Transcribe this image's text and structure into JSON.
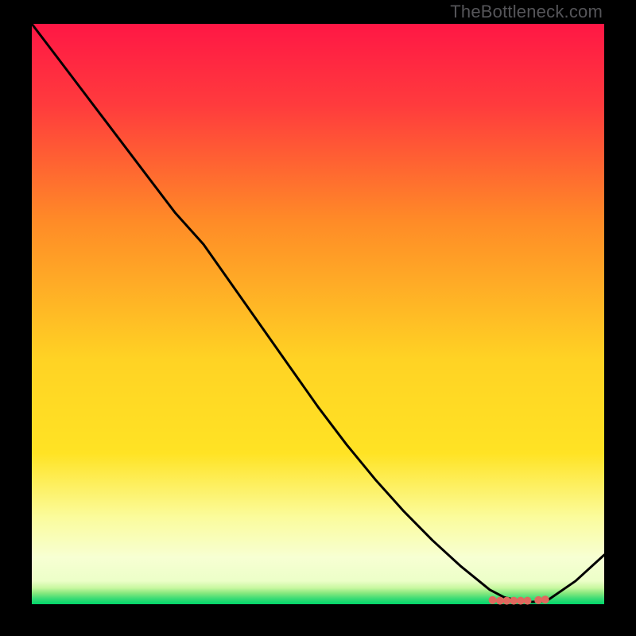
{
  "watermark": "TheBottleneck.com",
  "chart_data": {
    "type": "line",
    "x": [
      0.0,
      0.05,
      0.1,
      0.15,
      0.2,
      0.25,
      0.3,
      0.35,
      0.4,
      0.45,
      0.5,
      0.55,
      0.6,
      0.65,
      0.7,
      0.75,
      0.8,
      0.825,
      0.85,
      0.875,
      0.9,
      0.95,
      1.0
    ],
    "values": [
      1.0,
      0.935,
      0.87,
      0.805,
      0.74,
      0.675,
      0.62,
      0.55,
      0.48,
      0.41,
      0.34,
      0.275,
      0.215,
      0.16,
      0.11,
      0.065,
      0.025,
      0.012,
      0.006,
      0.004,
      0.006,
      0.04,
      0.085
    ],
    "flat_band": {
      "x_start": 0.8,
      "x_end": 0.9,
      "y": 0.006
    },
    "title": "",
    "xlabel": "",
    "ylabel": "",
    "xlim": [
      0,
      1
    ],
    "ylim": [
      0,
      1
    ],
    "background_gradient": [
      "#ff1745",
      "#ff8b27",
      "#ffe324",
      "#fbfc9c",
      "#f7ffd3",
      "#00d66a"
    ],
    "line_color": "#000000",
    "dot_color": "#e0685e"
  }
}
